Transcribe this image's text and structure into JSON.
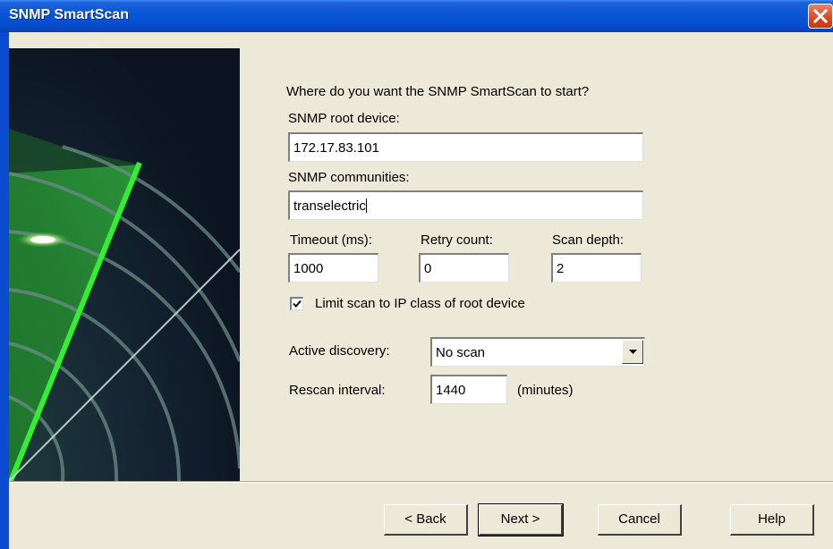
{
  "window": {
    "title": "SNMP SmartScan"
  },
  "prompt": "Where do you want the SNMP SmartScan to start?",
  "root_device": {
    "label": "SNMP root device:",
    "value": "172.17.83.101"
  },
  "communities": {
    "label": "SNMP communities:",
    "value": "transelectric"
  },
  "timeout": {
    "label": "Timeout (ms):",
    "value": "1000"
  },
  "retry": {
    "label": "Retry count:",
    "value": "0"
  },
  "depth": {
    "label": "Scan depth:",
    "value": "2"
  },
  "limit_scan": {
    "label": "Limit scan to IP class of root device",
    "checked": true
  },
  "active_discovery": {
    "label": "Active discovery:",
    "value": "No scan"
  },
  "rescan": {
    "label": "Rescan interval:",
    "value": "1440",
    "unit": "(minutes)"
  },
  "buttons": {
    "back": "< Back",
    "next": "Next >",
    "cancel": "Cancel",
    "help": "Help"
  },
  "icons": {
    "close": "close-icon",
    "check": "checkmark-icon",
    "dropdown": "chevron-down-icon",
    "banner": "radar-image"
  },
  "colors": {
    "titlebar": "#0a56d8",
    "dialog_bg": "#ece9d8",
    "close_button": "#d9471f",
    "radar_beam": "#2fdc2f"
  }
}
